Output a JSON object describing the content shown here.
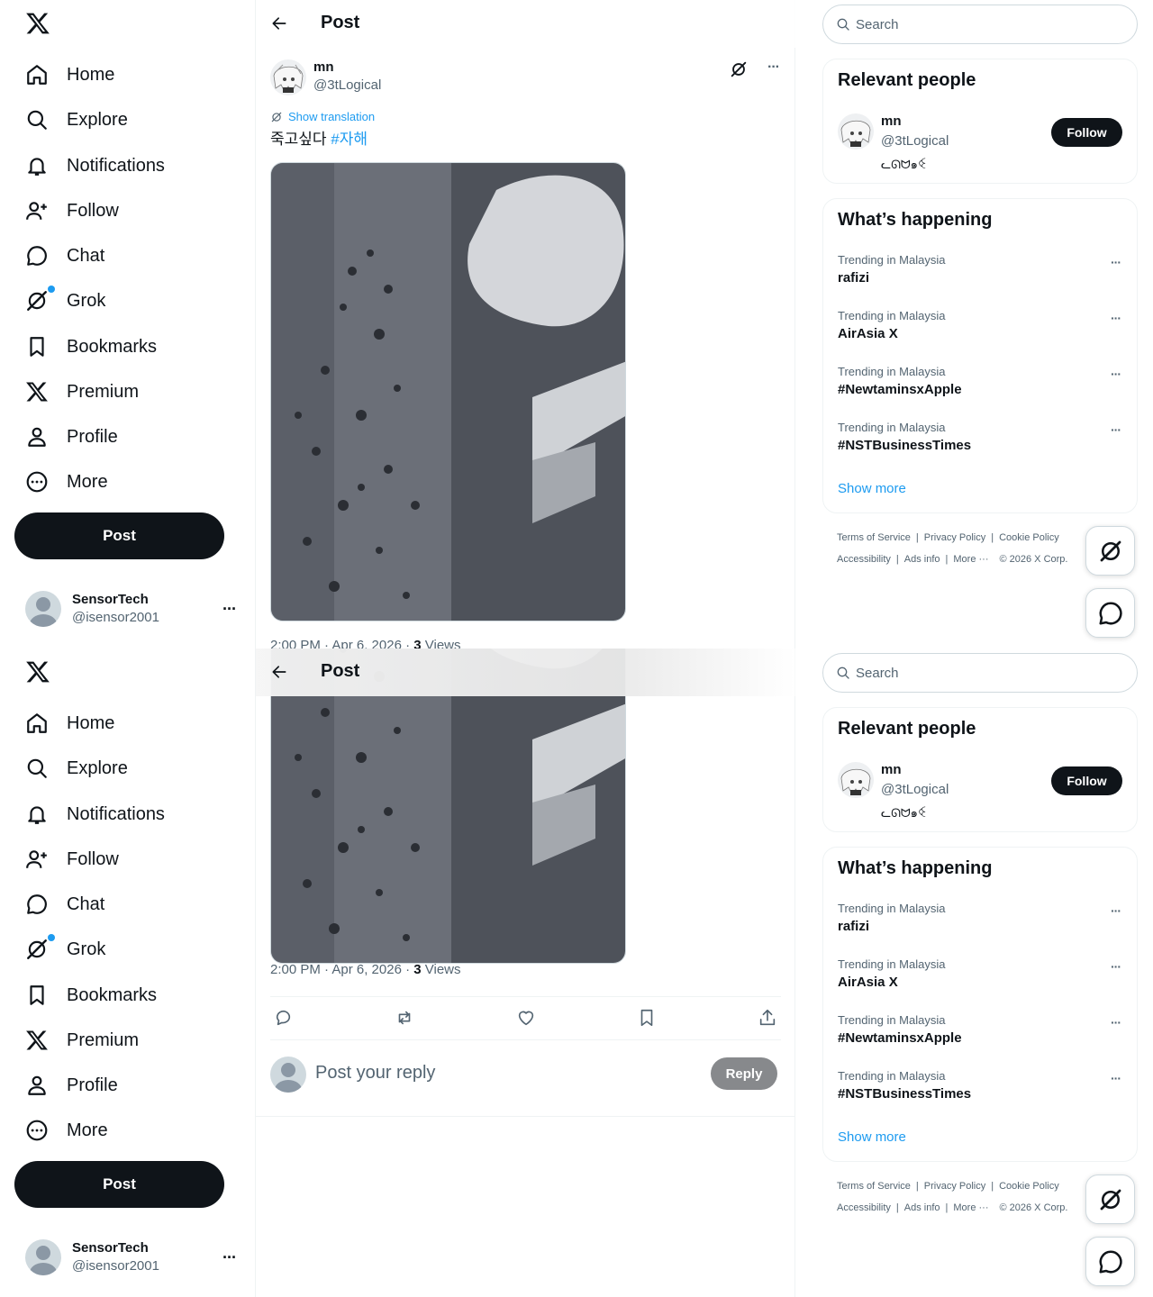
{
  "nav": {
    "items": [
      {
        "label": "Home"
      },
      {
        "label": "Explore"
      },
      {
        "label": "Notifications"
      },
      {
        "label": "Follow"
      },
      {
        "label": "Chat"
      },
      {
        "label": "Grok"
      },
      {
        "label": "Bookmarks"
      },
      {
        "label": "Premium"
      },
      {
        "label": "Profile"
      },
      {
        "label": "More"
      }
    ],
    "post_label": "Post"
  },
  "account": {
    "name": "SensorTech",
    "handle": "@isensor2001",
    "more": "···"
  },
  "header": {
    "title": "Post"
  },
  "post": {
    "author_name": "mn",
    "author_handle": "@3tLogical",
    "more": "···",
    "show_translation": "Show translation",
    "text": "죽고싶다",
    "hashtag": "#자해",
    "time": "2:00 PM · Apr 6, 2026 · ",
    "views_count": "3",
    "views_label": " Views"
  },
  "reply": {
    "placeholder": "Post your reply",
    "button": "Reply"
  },
  "search": {
    "placeholder": "Search"
  },
  "relevant_people": {
    "title": "Relevant people",
    "name": "mn",
    "handle": "@3tLogical",
    "bio": "ᓚᘏᗢ๑ꒊ",
    "follow": "Follow"
  },
  "whats_happening": {
    "title": "What’s happening",
    "trends": [
      {
        "context": "Trending in Malaysia",
        "name": "rafizi"
      },
      {
        "context": "Trending in Malaysia",
        "name": "AirAsia X"
      },
      {
        "context": "Trending in Malaysia",
        "name": "#NewtaminsxApple"
      },
      {
        "context": "Trending in Malaysia",
        "name": "#NSTBusinessTimes"
      }
    ],
    "trend_more": "···",
    "show_more": "Show more"
  },
  "footer": {
    "terms": "Terms of Service",
    "privacy": "Privacy Policy",
    "cookie": "Cookie Policy",
    "accessibility": "Accessibility",
    "ads": "Ads info",
    "more": "More ···",
    "copyright": "© 2026 X Corp."
  },
  "colors": {
    "accent": "#1d9bf0",
    "text": "#0f1419",
    "muted": "#536471"
  }
}
